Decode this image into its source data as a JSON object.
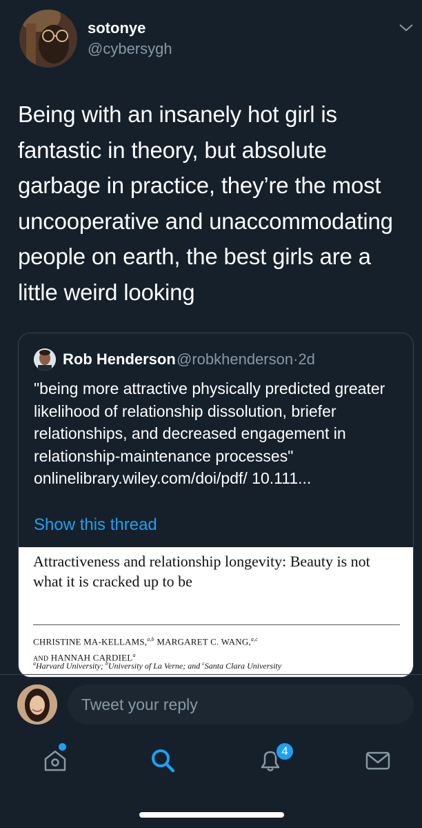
{
  "tweet": {
    "display_name": "sotonye",
    "handle": "@cybersygh",
    "text": "Being with an insanely hot girl is fantastic in theory, but absolute garbage in practice, they’re the most uncooperative and unaccommodating people on earth, the best girls are a little weird looking",
    "menu_icon": "chevron-down-icon"
  },
  "quote": {
    "display_name": "Rob Henderson",
    "handle": "@robkhenderson",
    "time": "2d",
    "separator": "·",
    "text": "\"being more attractive physically predicted greater likelihood of relationship dissolution, briefer relationships, and decreased engagement in relationship-maintenance processes\" onlinelibrary.wiley.com/doi/pdf/ 10.111...",
    "show_thread": "Show this thread",
    "paper": {
      "title": "Attractiveness and relationship longevity: Beauty is not what it is cracked up to be",
      "author1": "CHRISTINE MA-KELLAMS,",
      "author1_sup": "a,b",
      "author2": " MARGARET C. WANG,",
      "author2_sup": "a,c",
      "and_word": "AND",
      "author3": " HANNAH CARDIEL",
      "author3_sup": "a",
      "affil_a_sup": "a",
      "affil_a": "Harvard University; ",
      "affil_b_sup": "b",
      "affil_b": "University of La Verne; and ",
      "affil_c_sup": "c",
      "affil_c": "Santa Clara University"
    }
  },
  "reply": {
    "placeholder": "Tweet your reply"
  },
  "tabbar": {
    "home_icon": "home-icon",
    "search_icon": "search-icon",
    "notifications_icon": "bell-icon",
    "notifications_count": "4",
    "messages_icon": "mail-icon"
  },
  "colors": {
    "background": "#15202b",
    "accent": "#1da1f2",
    "secondary_text": "#8899a6",
    "border": "#38444d"
  }
}
